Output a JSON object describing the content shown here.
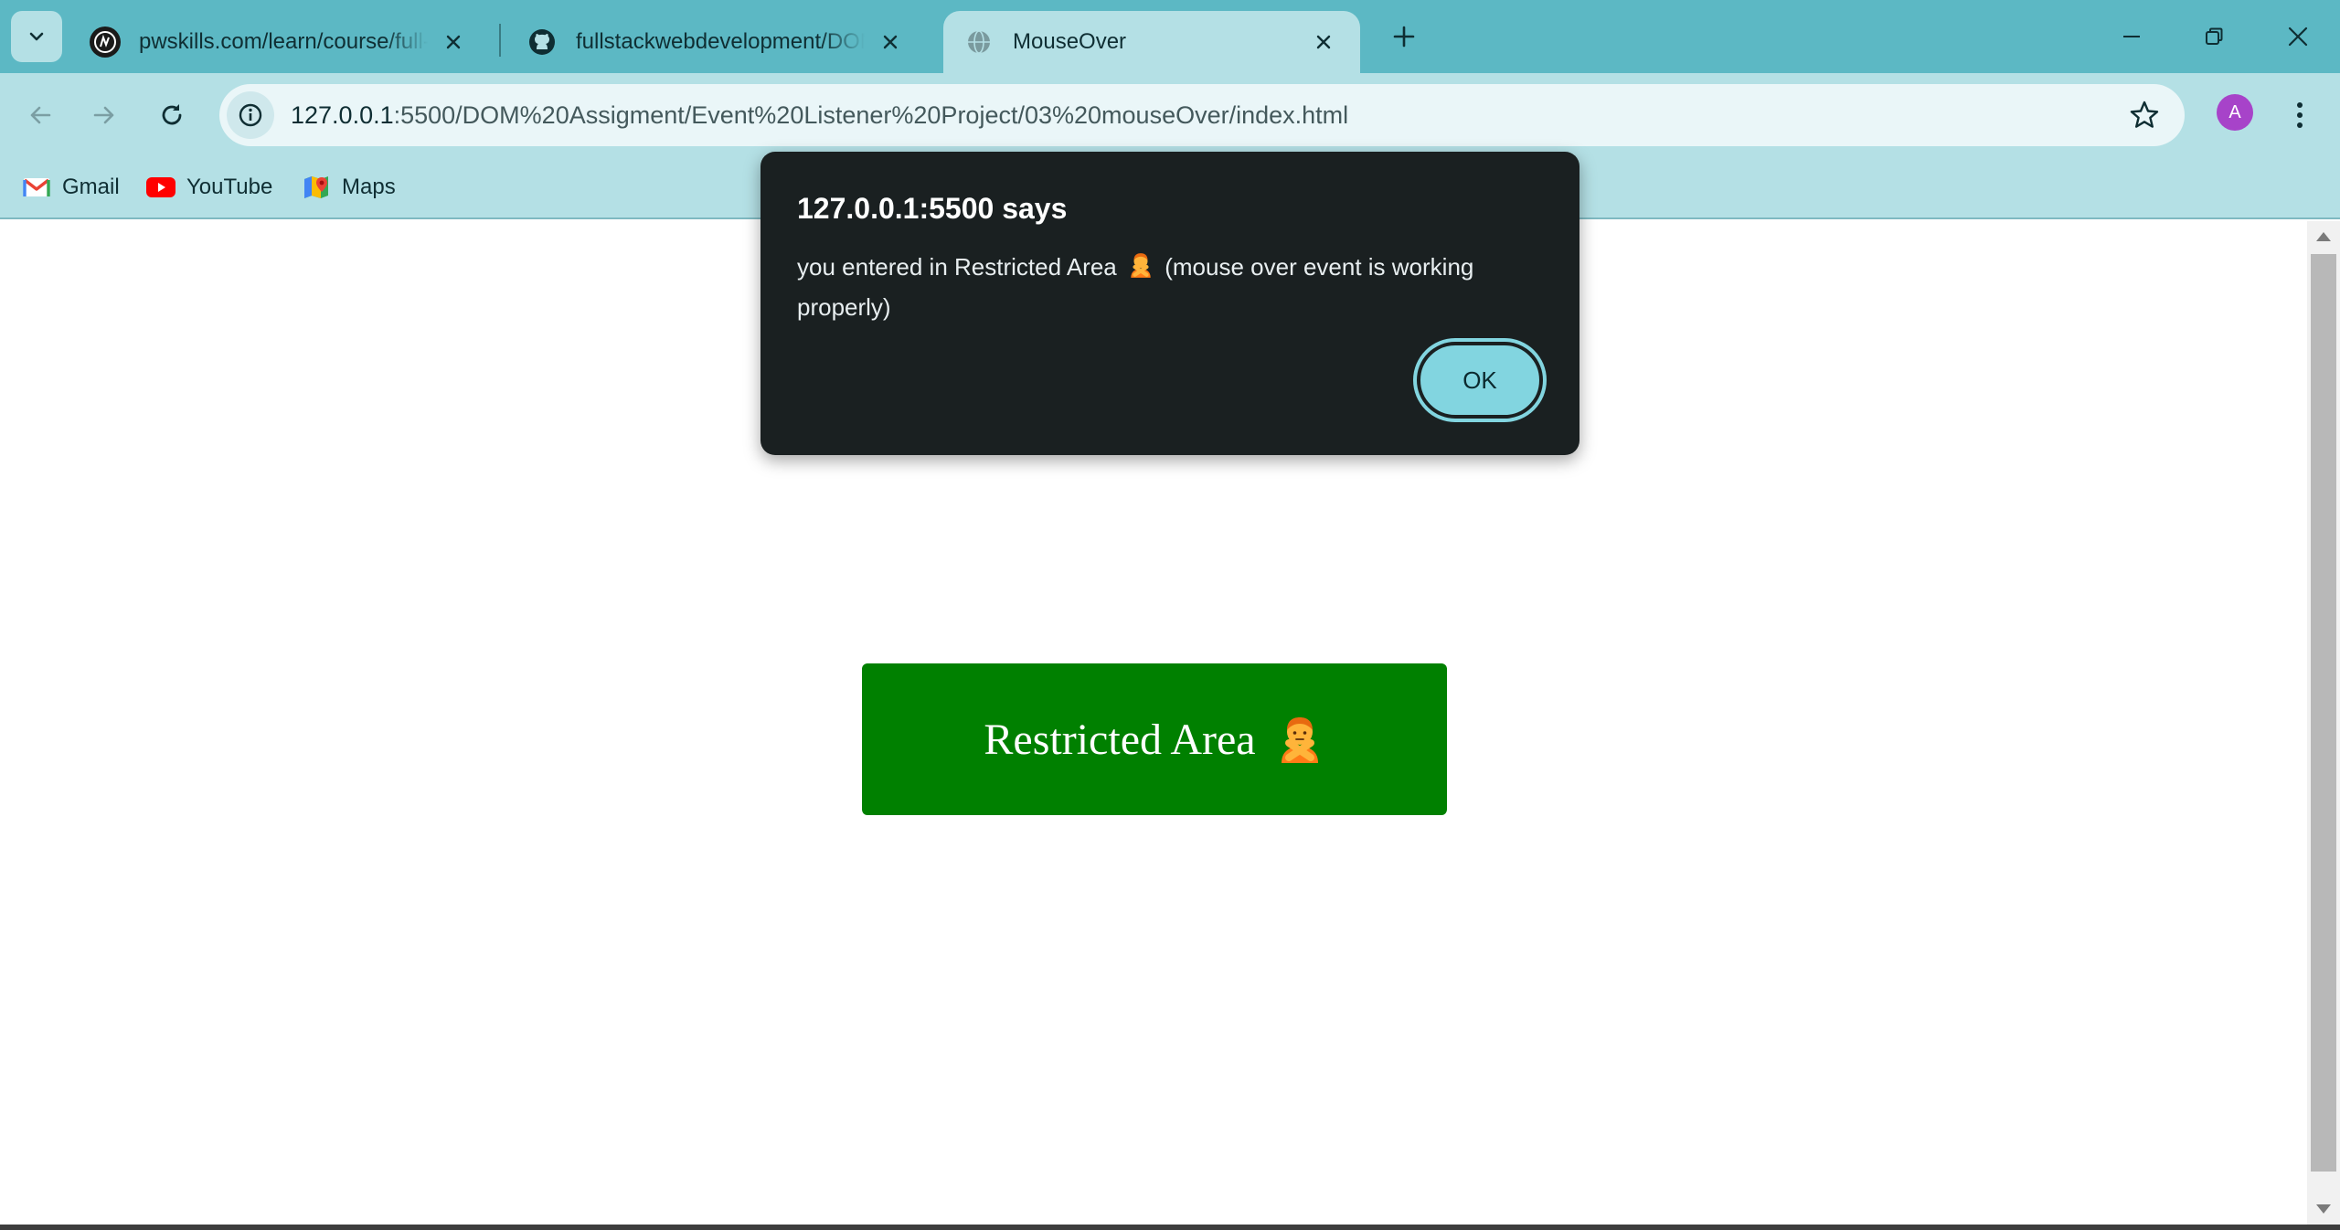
{
  "browser": {
    "tabs": [
      {
        "title": "pwskills.com/learn/course/full-stack",
        "favicon": "pwskills-favicon",
        "active": false
      },
      {
        "title": "fullstackwebdevelopment/DOM",
        "favicon": "github-icon",
        "active": false
      },
      {
        "title": "MouseOver",
        "favicon": "globe-icon",
        "active": true
      }
    ],
    "url": {
      "host": "127.0.0.1",
      "rest": ":5500/DOM%20Assigment/Event%20Listener%20Project/03%20mouseOver/index.html"
    },
    "profile_initial": "A",
    "bookmarks": [
      {
        "label": "Gmail",
        "icon": "gmail-icon"
      },
      {
        "label": "YouTube",
        "icon": "youtube-icon"
      },
      {
        "label": "Maps",
        "icon": "maps-icon"
      }
    ]
  },
  "page": {
    "restricted_label": "Restricted Area",
    "restricted_emoji": "🙅"
  },
  "dialog": {
    "title": "127.0.0.1:5500 says",
    "message_before": "you entered in Restricted Area",
    "message_emoji": "🙅",
    "message_after": "(mouse over event is working properly)",
    "ok_label": "OK"
  },
  "colors": {
    "tabstrip": "#5cb8c4",
    "toolbar": "#b4e0e5",
    "button_green": "#008000",
    "dialog_bg": "#1a2021",
    "ok_button": "#82d5e0",
    "avatar": "#a743c9"
  }
}
